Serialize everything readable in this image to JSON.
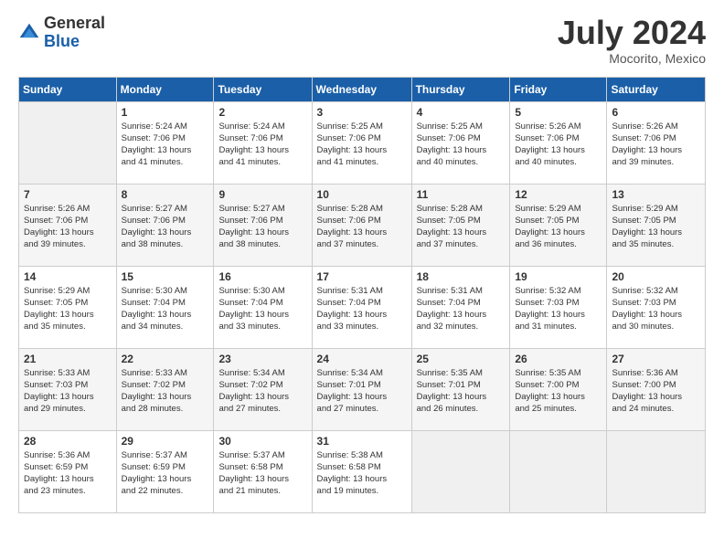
{
  "header": {
    "logo_general": "General",
    "logo_blue": "Blue",
    "month_title": "July 2024",
    "location": "Mocorito, Mexico"
  },
  "calendar": {
    "days_of_week": [
      "Sunday",
      "Monday",
      "Tuesday",
      "Wednesday",
      "Thursday",
      "Friday",
      "Saturday"
    ],
    "weeks": [
      [
        {
          "day": "",
          "info": ""
        },
        {
          "day": "1",
          "info": "Sunrise: 5:24 AM\nSunset: 7:06 PM\nDaylight: 13 hours\nand 41 minutes."
        },
        {
          "day": "2",
          "info": "Sunrise: 5:24 AM\nSunset: 7:06 PM\nDaylight: 13 hours\nand 41 minutes."
        },
        {
          "day": "3",
          "info": "Sunrise: 5:25 AM\nSunset: 7:06 PM\nDaylight: 13 hours\nand 41 minutes."
        },
        {
          "day": "4",
          "info": "Sunrise: 5:25 AM\nSunset: 7:06 PM\nDaylight: 13 hours\nand 40 minutes."
        },
        {
          "day": "5",
          "info": "Sunrise: 5:26 AM\nSunset: 7:06 PM\nDaylight: 13 hours\nand 40 minutes."
        },
        {
          "day": "6",
          "info": "Sunrise: 5:26 AM\nSunset: 7:06 PM\nDaylight: 13 hours\nand 39 minutes."
        }
      ],
      [
        {
          "day": "7",
          "info": "Sunrise: 5:26 AM\nSunset: 7:06 PM\nDaylight: 13 hours\nand 39 minutes."
        },
        {
          "day": "8",
          "info": "Sunrise: 5:27 AM\nSunset: 7:06 PM\nDaylight: 13 hours\nand 38 minutes."
        },
        {
          "day": "9",
          "info": "Sunrise: 5:27 AM\nSunset: 7:06 PM\nDaylight: 13 hours\nand 38 minutes."
        },
        {
          "day": "10",
          "info": "Sunrise: 5:28 AM\nSunset: 7:06 PM\nDaylight: 13 hours\nand 37 minutes."
        },
        {
          "day": "11",
          "info": "Sunrise: 5:28 AM\nSunset: 7:05 PM\nDaylight: 13 hours\nand 37 minutes."
        },
        {
          "day": "12",
          "info": "Sunrise: 5:29 AM\nSunset: 7:05 PM\nDaylight: 13 hours\nand 36 minutes."
        },
        {
          "day": "13",
          "info": "Sunrise: 5:29 AM\nSunset: 7:05 PM\nDaylight: 13 hours\nand 35 minutes."
        }
      ],
      [
        {
          "day": "14",
          "info": "Sunrise: 5:29 AM\nSunset: 7:05 PM\nDaylight: 13 hours\nand 35 minutes."
        },
        {
          "day": "15",
          "info": "Sunrise: 5:30 AM\nSunset: 7:04 PM\nDaylight: 13 hours\nand 34 minutes."
        },
        {
          "day": "16",
          "info": "Sunrise: 5:30 AM\nSunset: 7:04 PM\nDaylight: 13 hours\nand 33 minutes."
        },
        {
          "day": "17",
          "info": "Sunrise: 5:31 AM\nSunset: 7:04 PM\nDaylight: 13 hours\nand 33 minutes."
        },
        {
          "day": "18",
          "info": "Sunrise: 5:31 AM\nSunset: 7:04 PM\nDaylight: 13 hours\nand 32 minutes."
        },
        {
          "day": "19",
          "info": "Sunrise: 5:32 AM\nSunset: 7:03 PM\nDaylight: 13 hours\nand 31 minutes."
        },
        {
          "day": "20",
          "info": "Sunrise: 5:32 AM\nSunset: 7:03 PM\nDaylight: 13 hours\nand 30 minutes."
        }
      ],
      [
        {
          "day": "21",
          "info": "Sunrise: 5:33 AM\nSunset: 7:03 PM\nDaylight: 13 hours\nand 29 minutes."
        },
        {
          "day": "22",
          "info": "Sunrise: 5:33 AM\nSunset: 7:02 PM\nDaylight: 13 hours\nand 28 minutes."
        },
        {
          "day": "23",
          "info": "Sunrise: 5:34 AM\nSunset: 7:02 PM\nDaylight: 13 hours\nand 27 minutes."
        },
        {
          "day": "24",
          "info": "Sunrise: 5:34 AM\nSunset: 7:01 PM\nDaylight: 13 hours\nand 27 minutes."
        },
        {
          "day": "25",
          "info": "Sunrise: 5:35 AM\nSunset: 7:01 PM\nDaylight: 13 hours\nand 26 minutes."
        },
        {
          "day": "26",
          "info": "Sunrise: 5:35 AM\nSunset: 7:00 PM\nDaylight: 13 hours\nand 25 minutes."
        },
        {
          "day": "27",
          "info": "Sunrise: 5:36 AM\nSunset: 7:00 PM\nDaylight: 13 hours\nand 24 minutes."
        }
      ],
      [
        {
          "day": "28",
          "info": "Sunrise: 5:36 AM\nSunset: 6:59 PM\nDaylight: 13 hours\nand 23 minutes."
        },
        {
          "day": "29",
          "info": "Sunrise: 5:37 AM\nSunset: 6:59 PM\nDaylight: 13 hours\nand 22 minutes."
        },
        {
          "day": "30",
          "info": "Sunrise: 5:37 AM\nSunset: 6:58 PM\nDaylight: 13 hours\nand 21 minutes."
        },
        {
          "day": "31",
          "info": "Sunrise: 5:38 AM\nSunset: 6:58 PM\nDaylight: 13 hours\nand 19 minutes."
        },
        {
          "day": "",
          "info": ""
        },
        {
          "day": "",
          "info": ""
        },
        {
          "day": "",
          "info": ""
        }
      ]
    ]
  }
}
